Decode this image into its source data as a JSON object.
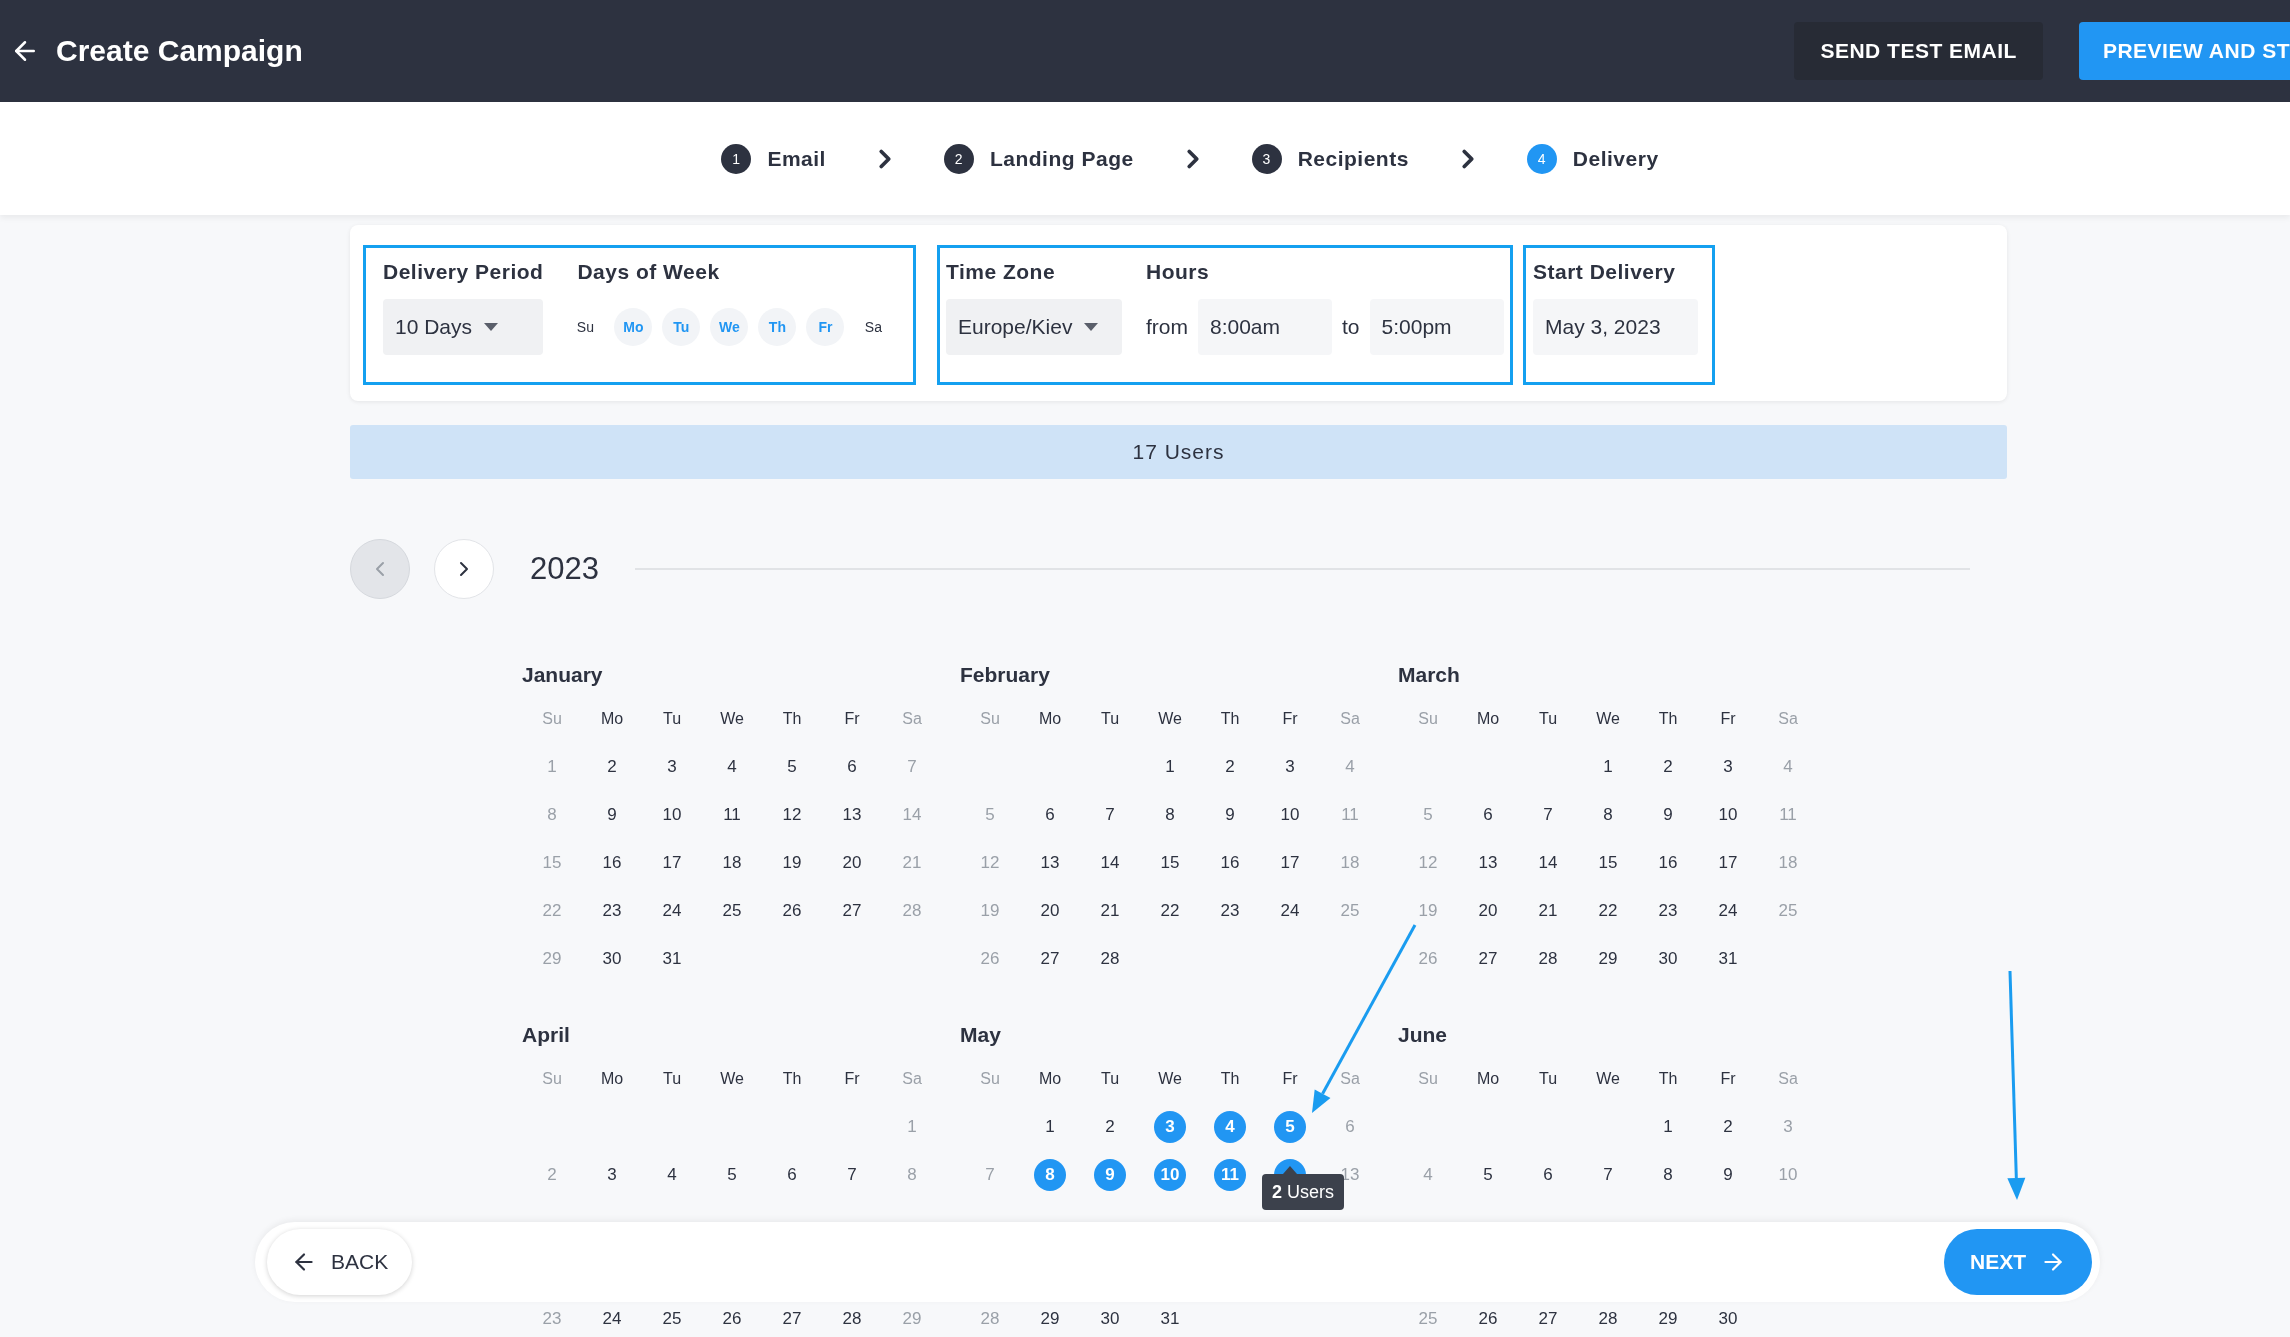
{
  "header": {
    "title": "Create Campaign",
    "buttons": [
      {
        "label": "SEND TEST EMAIL",
        "kind": "secondary"
      },
      {
        "label": "PREVIEW AND ST",
        "kind": "primary"
      }
    ]
  },
  "steps": [
    {
      "number": "1",
      "label": "Email",
      "selected": false
    },
    {
      "number": "2",
      "label": "Landing Page",
      "selected": false
    },
    {
      "number": "3",
      "label": "Recipients",
      "selected": false
    },
    {
      "number": "4",
      "label": "Delivery",
      "selected": true
    }
  ],
  "settings": {
    "delivery_period": {
      "label": "Delivery Period",
      "value": "10 Days"
    },
    "days_of_week": {
      "label": "Days of Week",
      "days": [
        {
          "label": "Su",
          "selected": false
        },
        {
          "label": "Mo",
          "selected": true
        },
        {
          "label": "Tu",
          "selected": true
        },
        {
          "label": "We",
          "selected": true
        },
        {
          "label": "Th",
          "selected": true
        },
        {
          "label": "Fr",
          "selected": true
        },
        {
          "label": "Sa",
          "selected": false
        }
      ]
    },
    "time_zone": {
      "label": "Time Zone",
      "value": "Europe/Kiev"
    },
    "hours": {
      "label": "Hours",
      "from_label": "from",
      "from": "8:00am",
      "to_label": "to",
      "to": "5:00pm"
    },
    "start_delivery": {
      "label": "Start Delivery",
      "value": "May 3, 2023"
    }
  },
  "users_summary": "17 Users",
  "calendar": {
    "year": "2023",
    "months": [
      {
        "name": "January",
        "weekdays": [
          "Su",
          "Mo",
          "Tu",
          "We",
          "Th",
          "Fr",
          "Sa"
        ],
        "weeks": [
          {
            "kind": "week",
            "days": [
              {
                "day": "1",
                "selected": false
              },
              {
                "day": "2",
                "selected": false
              },
              {
                "day": "3",
                "selected": false
              },
              {
                "day": "4",
                "selected": false
              },
              {
                "day": "5",
                "selected": false
              },
              {
                "day": "6",
                "selected": false
              },
              {
                "day": "7",
                "selected": false
              }
            ]
          },
          {
            "kind": "week",
            "days": [
              {
                "day": "8",
                "selected": false
              },
              {
                "day": "9",
                "selected": false
              },
              {
                "day": "10",
                "selected": false
              },
              {
                "day": "11",
                "selected": false
              },
              {
                "day": "12",
                "selected": false
              },
              {
                "day": "13",
                "selected": false
              },
              {
                "day": "14",
                "selected": false
              }
            ]
          },
          {
            "kind": "week",
            "days": [
              {
                "day": "15",
                "selected": false
              },
              {
                "day": "16",
                "selected": false
              },
              {
                "day": "17",
                "selected": false
              },
              {
                "day": "18",
                "selected": false
              },
              {
                "day": "19",
                "selected": false
              },
              {
                "day": "20",
                "selected": false
              },
              {
                "day": "21",
                "selected": false
              }
            ]
          },
          {
            "kind": "week",
            "days": [
              {
                "day": "22",
                "selected": false
              },
              {
                "day": "23",
                "selected": false
              },
              {
                "day": "24",
                "selected": false
              },
              {
                "day": "25",
                "selected": false
              },
              {
                "day": "26",
                "selected": false
              },
              {
                "day": "27",
                "selected": false
              },
              {
                "day": "28",
                "selected": false
              }
            ]
          },
          {
            "kind": "week",
            "days": [
              {
                "day": "29",
                "selected": false
              },
              {
                "day": "30",
                "selected": false
              },
              {
                "day": "31",
                "selected": false
              }
            ]
          }
        ]
      },
      {
        "name": "February",
        "weekdays": [
          "Su",
          "Mo",
          "Tu",
          "We",
          "Th",
          "Fr",
          "Sa"
        ],
        "weeks": [
          {
            "kind": "first",
            "days": [
              {
                "day": "1",
                "selected": false
              },
              {
                "day": "2",
                "selected": false
              },
              {
                "day": "3",
                "selected": false
              },
              {
                "day": "4",
                "selected": false
              }
            ]
          },
          {
            "kind": "week",
            "days": [
              {
                "day": "5",
                "selected": false
              },
              {
                "day": "6",
                "selected": false
              },
              {
                "day": "7",
                "selected": false
              },
              {
                "day": "8",
                "selected": false
              },
              {
                "day": "9",
                "selected": false
              },
              {
                "day": "10",
                "selected": false
              },
              {
                "day": "11",
                "selected": false
              }
            ]
          },
          {
            "kind": "week",
            "days": [
              {
                "day": "12",
                "selected": false
              },
              {
                "day": "13",
                "selected": false
              },
              {
                "day": "14",
                "selected": false
              },
              {
                "day": "15",
                "selected": false
              },
              {
                "day": "16",
                "selected": false
              },
              {
                "day": "17",
                "selected": false
              },
              {
                "day": "18",
                "selected": false
              }
            ]
          },
          {
            "kind": "week",
            "days": [
              {
                "day": "19",
                "selected": false
              },
              {
                "day": "20",
                "selected": false
              },
              {
                "day": "21",
                "selected": false
              },
              {
                "day": "22",
                "selected": false
              },
              {
                "day": "23",
                "selected": false
              },
              {
                "day": "24",
                "selected": false
              },
              {
                "day": "25",
                "selected": false
              }
            ]
          },
          {
            "kind": "week",
            "days": [
              {
                "day": "26",
                "selected": false
              },
              {
                "day": "27",
                "selected": false
              },
              {
                "day": "28",
                "selected": false
              }
            ]
          }
        ]
      },
      {
        "name": "March",
        "weekdays": [
          "Su",
          "Mo",
          "Tu",
          "We",
          "Th",
          "Fr",
          "Sa"
        ],
        "weeks": [
          {
            "kind": "first",
            "days": [
              {
                "day": "1",
                "selected": false
              },
              {
                "day": "2",
                "selected": false
              },
              {
                "day": "3",
                "selected": false
              },
              {
                "day": "4",
                "selected": false
              }
            ]
          },
          {
            "kind": "week",
            "days": [
              {
                "day": "5",
                "selected": false
              },
              {
                "day": "6",
                "selected": false
              },
              {
                "day": "7",
                "selected": false
              },
              {
                "day": "8",
                "selected": false
              },
              {
                "day": "9",
                "selected": false
              },
              {
                "day": "10",
                "selected": false
              },
              {
                "day": "11",
                "selected": false
              }
            ]
          },
          {
            "kind": "week",
            "days": [
              {
                "day": "12",
                "selected": false
              },
              {
                "day": "13",
                "selected": false
              },
              {
                "day": "14",
                "selected": false
              },
              {
                "day": "15",
                "selected": false
              },
              {
                "day": "16",
                "selected": false
              },
              {
                "day": "17",
                "selected": false
              },
              {
                "day": "18",
                "selected": false
              }
            ]
          },
          {
            "kind": "week",
            "days": [
              {
                "day": "19",
                "selected": false
              },
              {
                "day": "20",
                "selected": false
              },
              {
                "day": "21",
                "selected": false
              },
              {
                "day": "22",
                "selected": false
              },
              {
                "day": "23",
                "selected": false
              },
              {
                "day": "24",
                "selected": false
              },
              {
                "day": "25",
                "selected": false
              }
            ]
          },
          {
            "kind": "week",
            "days": [
              {
                "day": "26",
                "selected": false
              },
              {
                "day": "27",
                "selected": false
              },
              {
                "day": "28",
                "selected": false
              },
              {
                "day": "29",
                "selected": false
              },
              {
                "day": "30",
                "selected": false
              },
              {
                "day": "31",
                "selected": false
              }
            ]
          }
        ]
      },
      {
        "name": "April",
        "weekdays": [
          "Su",
          "Mo",
          "Tu",
          "We",
          "Th",
          "Fr",
          "Sa"
        ],
        "weeks": [
          {
            "kind": "first",
            "days": [
              {
                "day": "1",
                "selected": false
              }
            ]
          },
          {
            "kind": "week",
            "days": [
              {
                "day": "2",
                "selected": false
              },
              {
                "day": "3",
                "selected": false
              },
              {
                "day": "4",
                "selected": false
              },
              {
                "day": "5",
                "selected": false
              },
              {
                "day": "6",
                "selected": false
              },
              {
                "day": "7",
                "selected": false
              },
              {
                "day": "8",
                "selected": false
              }
            ]
          },
          {
            "kind": "covered"
          },
          {
            "kind": "covered"
          },
          {
            "kind": "week",
            "days": [
              {
                "day": "23",
                "selected": false
              },
              {
                "day": "24",
                "selected": false
              },
              {
                "day": "25",
                "selected": false
              },
              {
                "day": "26",
                "selected": false
              },
              {
                "day": "27",
                "selected": false
              },
              {
                "day": "28",
                "selected": false
              },
              {
                "day": "29",
                "selected": false
              }
            ]
          }
        ]
      },
      {
        "name": "May",
        "weekdays": [
          "Su",
          "Mo",
          "Tu",
          "We",
          "Th",
          "Fr",
          "Sa"
        ],
        "weeks": [
          {
            "kind": "first",
            "days": [
              {
                "day": "1",
                "selected": false
              },
              {
                "day": "2",
                "selected": false
              },
              {
                "day": "3",
                "selected": true
              },
              {
                "day": "4",
                "selected": true
              },
              {
                "day": "5",
                "selected": true
              },
              {
                "day": "6",
                "selected": false
              }
            ]
          },
          {
            "kind": "week",
            "days": [
              {
                "day": "7",
                "selected": false
              },
              {
                "day": "8",
                "selected": true
              },
              {
                "day": "9",
                "selected": true
              },
              {
                "day": "10",
                "selected": true
              },
              {
                "day": "11",
                "selected": true
              },
              {
                "selected": true,
                "tooltip": "**2** Users"
              },
              {
                "day": "13",
                "selected": false
              }
            ]
          },
          {
            "kind": "covered"
          },
          {
            "kind": "covered"
          },
          {
            "kind": "week",
            "days": [
              {
                "day": "28",
                "selected": false
              },
              {
                "day": "29",
                "selected": false
              },
              {
                "day": "30",
                "selected": false
              },
              {
                "day": "31",
                "selected": false
              }
            ]
          }
        ]
      },
      {
        "name": "June",
        "weekdays": [
          "Su",
          "Mo",
          "Tu",
          "We",
          "Th",
          "Fr",
          "Sa"
        ],
        "weeks": [
          {
            "kind": "first",
            "days": [
              {
                "day": "1",
                "selected": false
              },
              {
                "day": "2",
                "selected": false
              },
              {
                "day": "3",
                "selected": false
              }
            ]
          },
          {
            "kind": "week",
            "days": [
              {
                "day": "4",
                "selected": false
              },
              {
                "day": "5",
                "selected": false
              },
              {
                "day": "6",
                "selected": false
              },
              {
                "day": "7",
                "selected": false
              },
              {
                "day": "8",
                "selected": false
              },
              {
                "day": "9",
                "selected": false
              },
              {
                "day": "10",
                "selected": false
              }
            ]
          },
          {
            "kind": "covered"
          },
          {
            "kind": "covered"
          },
          {
            "kind": "week",
            "days": [
              {
                "day": "25",
                "selected": false
              },
              {
                "day": "26",
                "selected": false
              },
              {
                "day": "27",
                "selected": false
              },
              {
                "day": "28",
                "selected": false
              },
              {
                "day": "29",
                "selected": false
              },
              {
                "day": "30",
                "selected": false
              }
            ]
          }
        ]
      }
    ]
  },
  "footer": {
    "back": "BACK",
    "next": "NEXT"
  }
}
